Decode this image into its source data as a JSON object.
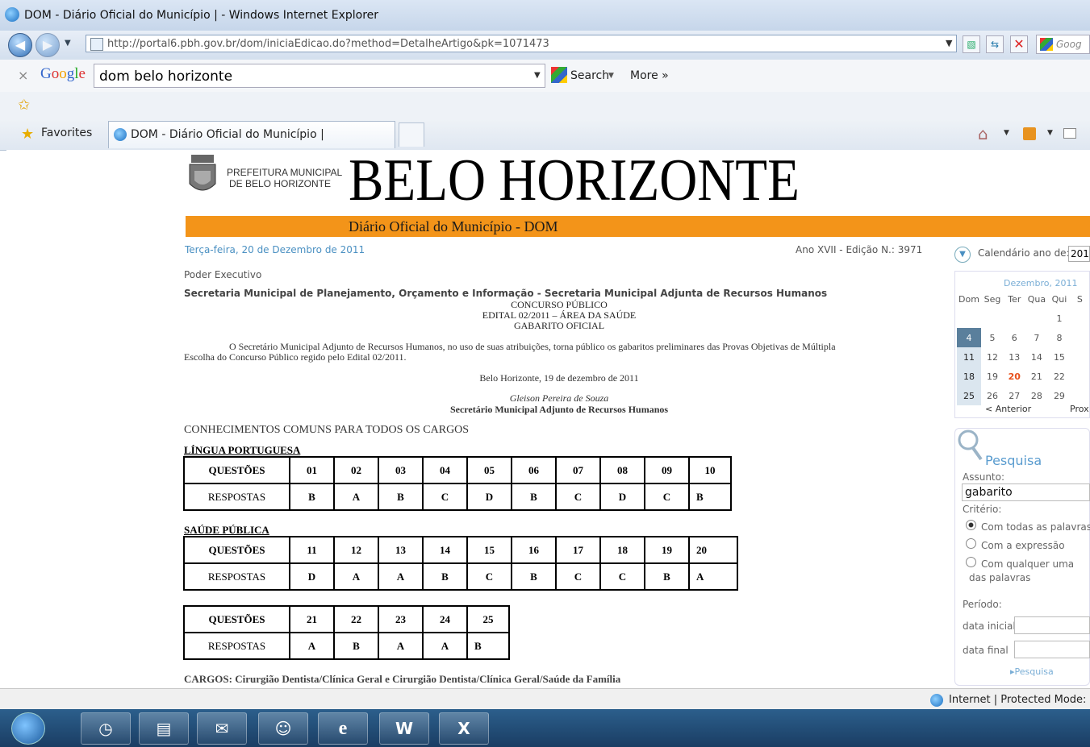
{
  "window": {
    "title": "DOM - Diário Oficial do Município | - Windows Internet Explorer"
  },
  "address": {
    "url": "http://portal6.pbh.gov.br/dom/iniciaEdicao.do?method=DetalheArtigo&pk=1071473"
  },
  "google": {
    "brand": "Google",
    "query": "dom belo horizonte",
    "search_label": "Search",
    "more_label": "More »",
    "close": "×"
  },
  "toolbar_right": {
    "google_label": "Goog"
  },
  "favorites": {
    "label": "Favorites",
    "tab_label": "DOM - Diário Oficial do Município |"
  },
  "header": {
    "prefeitura_line1": "PREFEITURA MUNICIPAL",
    "prefeitura_line2": "DE BELO HORIZONTE",
    "city": "BELO HORIZONTE",
    "banner": "Diário Oficial do Município - DOM"
  },
  "edition": {
    "date": "Terça-feira, 20 de Dezembro de 2011",
    "number": "Ano XVII - Edição N.: 3971"
  },
  "article": {
    "section": "Poder Executivo",
    "secretaria": "Secretaria Municipal de Planejamento, Orçamento e Informação - Secretaria Municipal Adjunta de Recursos Humanos",
    "title1": "CONCURSO PÚBLICO",
    "title2": "EDITAL 02/2011 – ÁREA DA SAÚDE",
    "title3": "GABARITO OFICIAL",
    "body1": "O Secretário Municipal Adjunto de Recursos Humanos, no uso de suas atribuições, torna público os gabaritos preliminares das Provas Objetivas de Múltipla",
    "body2": "Escolha do Concurso Público regido pelo Edital 02/2011.",
    "place_date": "Belo Horizonte, 19 de dezembro de 2011",
    "signer": "Gleison Pereira de Souza",
    "signer_title": "Secretário Municipal Adjunto de Recursos Humanos",
    "common": "CONHECIMENTOS COMUNS PARA TODOS OS CARGOS",
    "sub1": "LÍNGUA PORTUGUESA",
    "sub2": "SAÚDE PÚBLICA",
    "q_label": "QUESTÕES",
    "r_label": "RESPOSTAS",
    "t1_q": [
      "01",
      "02",
      "03",
      "04",
      "05",
      "06",
      "07",
      "08",
      "09",
      "10"
    ],
    "t1_r": [
      "B",
      "A",
      "B",
      "C",
      "D",
      "B",
      "C",
      "D",
      "C",
      "B"
    ],
    "t2_q": [
      "11",
      "12",
      "13",
      "14",
      "15",
      "16",
      "17",
      "18",
      "19",
      "20"
    ],
    "t2_r": [
      "D",
      "A",
      "A",
      "B",
      "C",
      "B",
      "C",
      "C",
      "B",
      "A"
    ],
    "t3_q": [
      "21",
      "22",
      "23",
      "24",
      "25"
    ],
    "t3_r": [
      "A",
      "B",
      "A",
      "A",
      "B"
    ],
    "cargos": "CARGOS: Cirurgião Dentista/Clínica Geral e Cirurgião Dentista/Clínica Geral/Saúde da Família"
  },
  "calendar": {
    "label": "Calendário ano de:",
    "year_value": "201",
    "month": "Dezembro, 2011",
    "days": [
      "Dom",
      "Seg",
      "Ter",
      "Qua",
      "Qui",
      "S"
    ],
    "weeks": [
      [
        "",
        "",
        "",
        "",
        "1",
        ""
      ],
      [
        "4",
        "5",
        "6",
        "7",
        "8",
        ""
      ],
      [
        "11",
        "12",
        "13",
        "14",
        "15",
        ""
      ],
      [
        "18",
        "19",
        "20",
        "21",
        "22",
        ""
      ],
      [
        "25",
        "26",
        "27",
        "28",
        "29",
        ""
      ]
    ],
    "prev": "< Anterior",
    "next": "Prox"
  },
  "pesquisa": {
    "title": "Pesquisa",
    "assunto_label": "Assunto:",
    "assunto_value": "gabarito",
    "criterio_label": "Critério:",
    "opt1": "Com todas as palavras",
    "opt2": "Com a expressão",
    "opt3a": "Com qualquer uma",
    "opt3b": "das palavras",
    "periodo_label": "Período:",
    "data_inicial": "data inicial",
    "data_final": "data final",
    "button": "▸Pesquisa"
  },
  "status": {
    "zone": "Internet | Protected Mode: C"
  },
  "colors": {
    "orange": "#f39419",
    "date_blue": "#4a90c2",
    "today_red": "#e8501c"
  }
}
